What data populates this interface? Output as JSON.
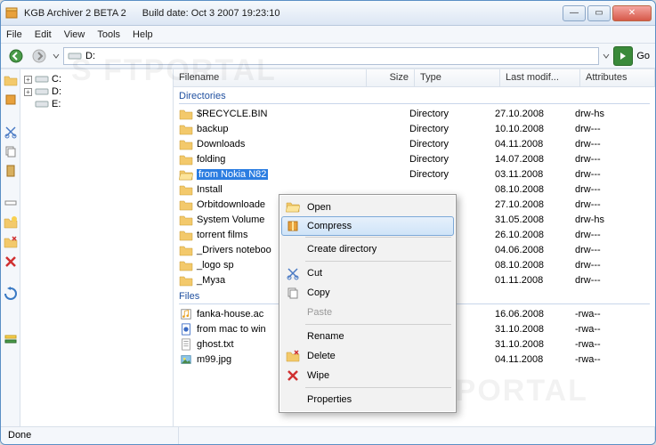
{
  "title": {
    "app": "KGB Archiver 2 BETA 2",
    "build": "Build date: Oct  3 2007 19:23:10"
  },
  "menu": [
    "File",
    "Edit",
    "View",
    "Tools",
    "Help"
  ],
  "address": "D:",
  "go_label": "Go",
  "tree": [
    {
      "label": "C:"
    },
    {
      "label": "D:"
    },
    {
      "label": "E:"
    }
  ],
  "columns": {
    "name": "Filename",
    "size": "Size",
    "type": "Type",
    "mod": "Last modif...",
    "attr": "Attributes"
  },
  "sections": {
    "dirs_label": "Directories",
    "files_label": "Files"
  },
  "dirs": [
    {
      "name": "$RECYCLE.BIN",
      "type": "Directory",
      "mod": "27.10.2008",
      "attr": "drw-hs"
    },
    {
      "name": "backup",
      "type": "Directory",
      "mod": "10.10.2008",
      "attr": "drw---"
    },
    {
      "name": "Downloads",
      "type": "Directory",
      "mod": "04.11.2008",
      "attr": "drw---"
    },
    {
      "name": "folding",
      "type": "Directory",
      "mod": "14.07.2008",
      "attr": "drw---"
    },
    {
      "name": "from Nokia N82",
      "type": "Directory",
      "mod": "03.11.2008",
      "attr": "drw---",
      "selected": true
    },
    {
      "name": "Install",
      "type": "",
      "mod": "08.10.2008",
      "attr": "drw---"
    },
    {
      "name": "Orbitdownloade",
      "type": "",
      "mod": "27.10.2008",
      "attr": "drw---"
    },
    {
      "name": "System Volume",
      "type": "",
      "mod": "31.05.2008",
      "attr": "drw-hs"
    },
    {
      "name": "torrent films",
      "type": "",
      "mod": "26.10.2008",
      "attr": "drw---"
    },
    {
      "name": "_Drivers noteboo",
      "type": "",
      "mod": "04.06.2008",
      "attr": "drw---"
    },
    {
      "name": "_logo sp",
      "type": "",
      "mod": "08.10.2008",
      "attr": "drw---"
    },
    {
      "name": "_Муза",
      "type": "",
      "mod": "01.11.2008",
      "attr": "drw---"
    }
  ],
  "files": [
    {
      "name": "fanka-house.ac",
      "mod": "16.06.2008",
      "attr": "-rwa--",
      "icon": "music"
    },
    {
      "name": "from mac to win",
      "mod": "31.10.2008",
      "attr": "-rwa--",
      "icon": "doc"
    },
    {
      "name": "ghost.txt",
      "mod": "31.10.2008",
      "attr": "-rwa--",
      "icon": "txt"
    },
    {
      "name": "m99.jpg",
      "mod": "04.11.2008",
      "attr": "-rwa--",
      "icon": "img"
    }
  ],
  "context": [
    {
      "label": "Open",
      "icon": "open"
    },
    {
      "label": "Compress",
      "icon": "compress",
      "hover": true
    },
    {
      "sep": true
    },
    {
      "label": "Create directory"
    },
    {
      "sep": true
    },
    {
      "label": "Cut",
      "icon": "cut"
    },
    {
      "label": "Copy",
      "icon": "copy"
    },
    {
      "label": "Paste",
      "disabled": true
    },
    {
      "sep": true
    },
    {
      "label": "Rename"
    },
    {
      "label": "Delete",
      "icon": "delete"
    },
    {
      "label": "Wipe",
      "icon": "wipe"
    },
    {
      "sep": true
    },
    {
      "label": "Properties"
    }
  ],
  "status": "Done"
}
